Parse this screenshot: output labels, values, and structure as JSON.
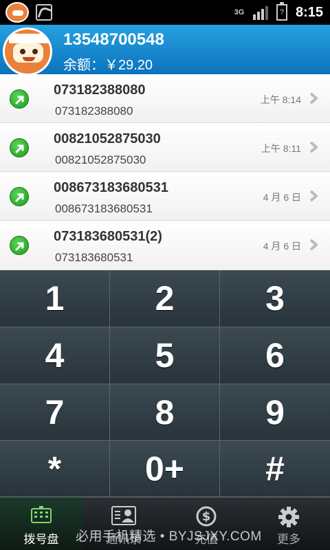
{
  "status_bar": {
    "network": "3G",
    "time": "8:15"
  },
  "header": {
    "phone_number": "13548700548",
    "balance": "余额：￥29.20"
  },
  "call_log": [
    {
      "name": "073182388080",
      "number": "073182388080",
      "time": "上午 8:14"
    },
    {
      "name": "00821052875030",
      "number": "00821052875030",
      "time": "上午 8:11"
    },
    {
      "name": "008673183680531",
      "number": "008673183680531",
      "time": "4 月 6 日"
    },
    {
      "name": "073183680531(2)",
      "number": "073183680531",
      "time": "4 月 6 日"
    }
  ],
  "keypad": [
    "1",
    "2",
    "3",
    "4",
    "5",
    "6",
    "7",
    "8",
    "9",
    "*",
    "0+",
    "#"
  ],
  "tabs": [
    {
      "label": "拨号盘",
      "icon": "dialpad-icon",
      "active": true
    },
    {
      "label": "通讯录",
      "icon": "contacts-icon",
      "active": false
    },
    {
      "label": "充值",
      "icon": "recharge-icon",
      "active": false
    },
    {
      "label": "更多",
      "icon": "gear-icon",
      "active": false
    }
  ],
  "watermark": "必用手机精选 • BYJSJXY.COM"
}
